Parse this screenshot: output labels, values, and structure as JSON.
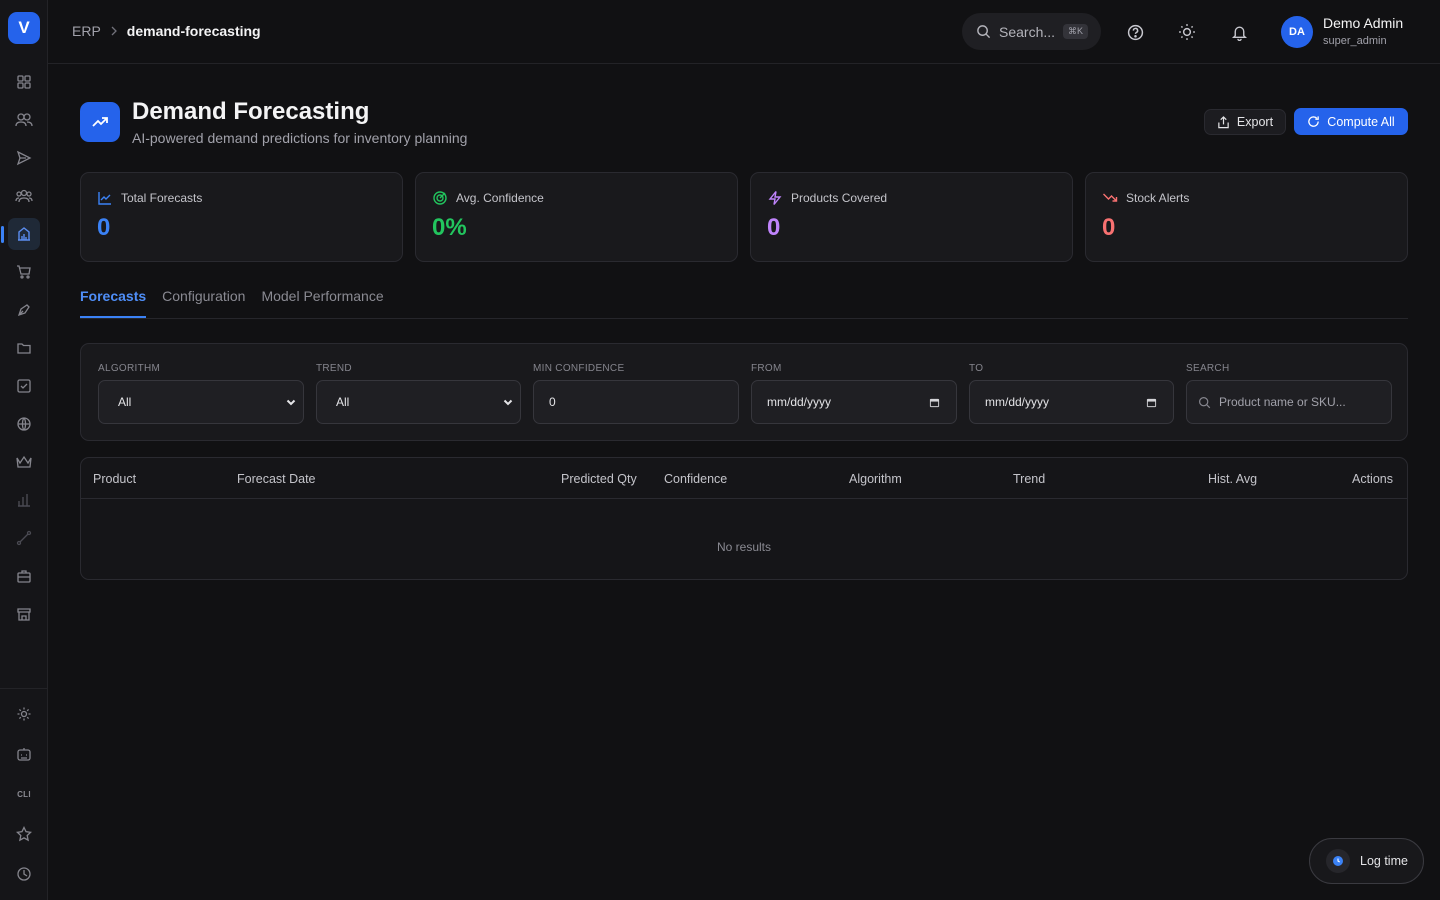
{
  "app": {
    "logo_letter": "V"
  },
  "sidebar": {
    "top_items": [
      {
        "icon": "dashboard-icon",
        "active": false
      },
      {
        "icon": "users-icon",
        "active": false
      },
      {
        "icon": "send-icon",
        "active": false
      },
      {
        "icon": "team-icon",
        "active": false
      },
      {
        "icon": "building-chart-icon",
        "active": true
      },
      {
        "icon": "cart-icon",
        "active": false
      },
      {
        "icon": "pen-tool-icon",
        "active": false
      },
      {
        "icon": "folder-icon",
        "active": false
      },
      {
        "icon": "checkbox-icon",
        "active": false
      },
      {
        "icon": "globe-icon",
        "active": false
      },
      {
        "icon": "crown-icon",
        "active": false
      },
      {
        "icon": "bar-chart-icon",
        "active": false
      },
      {
        "icon": "route-icon",
        "active": false
      },
      {
        "icon": "briefcase-icon",
        "active": false
      },
      {
        "icon": "store-icon",
        "active": false
      }
    ],
    "bottom_items": [
      {
        "icon": "gear-icon"
      },
      {
        "icon": "robot-icon"
      },
      {
        "icon": "cli-icon",
        "label": "CLI"
      },
      {
        "icon": "star-icon"
      },
      {
        "icon": "clock-icon"
      }
    ]
  },
  "topbar": {
    "breadcrumb": {
      "root": "ERP",
      "current": "demand-forecasting"
    },
    "search": {
      "placeholder": "Search...",
      "shortcut": "⌘K"
    },
    "user": {
      "initials": "DA",
      "name": "Demo Admin",
      "role": "super_admin"
    }
  },
  "header": {
    "title": "Demand Forecasting",
    "subtitle": "AI-powered demand predictions for inventory planning",
    "export_label": "Export",
    "compute_label": "Compute All"
  },
  "stats": [
    {
      "label": "Total Forecasts",
      "value": "0",
      "color": "#3b82f6",
      "icon": "trend-up-icon"
    },
    {
      "label": "Avg. Confidence",
      "value": "0%",
      "color": "#22c55e",
      "icon": "target-icon"
    },
    {
      "label": "Products Covered",
      "value": "0",
      "color": "#c084fc",
      "icon": "bolt-icon"
    },
    {
      "label": "Stock Alerts",
      "value": "0",
      "color": "#f87171",
      "icon": "trend-down-icon"
    }
  ],
  "tabs": [
    {
      "label": "Forecasts",
      "active": true
    },
    {
      "label": "Configuration",
      "active": false
    },
    {
      "label": "Model Performance",
      "active": false
    }
  ],
  "filters": {
    "algorithm": {
      "label": "ALGORITHM",
      "value": "All"
    },
    "trend": {
      "label": "TREND",
      "value": "All"
    },
    "min_confidence": {
      "label": "MIN CONFIDENCE",
      "value": "0"
    },
    "from": {
      "label": "FROM",
      "value": "mm/dd/yyyy"
    },
    "to": {
      "label": "TO",
      "value": "mm/dd/yyyy"
    },
    "search": {
      "label": "SEARCH",
      "placeholder": "Product name or SKU..."
    }
  },
  "table": {
    "columns": [
      "Product",
      "Forecast Date",
      "Predicted Qty",
      "Confidence",
      "Algorithm",
      "Trend",
      "Hist. Avg",
      "Actions"
    ],
    "empty_text": "No results"
  },
  "log_time": {
    "label": "Log time"
  }
}
